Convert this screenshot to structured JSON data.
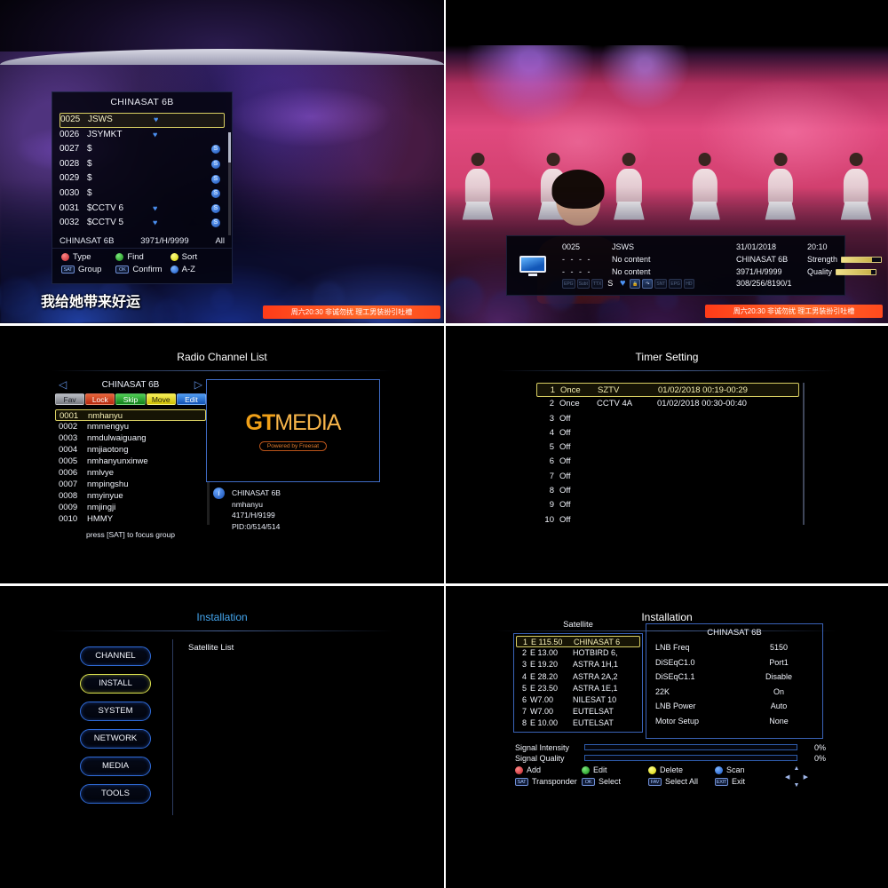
{
  "panels": {
    "channel_list_tv": {
      "osd_title": "CHINASAT 6B",
      "rows": [
        {
          "num": "0025",
          "name": "JSWS",
          "heart": true,
          "scrambled": false
        },
        {
          "num": "0026",
          "name": "JSYMKT",
          "heart": true,
          "scrambled": false
        },
        {
          "num": "0027",
          "name": "$",
          "heart": false,
          "scrambled": true
        },
        {
          "num": "0028",
          "name": "$",
          "heart": false,
          "scrambled": true
        },
        {
          "num": "0029",
          "name": "$",
          "heart": false,
          "scrambled": true
        },
        {
          "num": "0030",
          "name": "$",
          "heart": false,
          "scrambled": true
        },
        {
          "num": "0031",
          "name": "$CCTV 6",
          "heart": true,
          "scrambled": true
        },
        {
          "num": "0032",
          "name": "$CCTV 5",
          "heart": true,
          "scrambled": true
        }
      ],
      "footer": {
        "satellite": "CHINASAT 6B",
        "transponder": "3971/H/9999",
        "group": "All"
      },
      "hints": [
        {
          "key": "red",
          "label": "Type"
        },
        {
          "key": "green",
          "label": "Find"
        },
        {
          "key": "yellow",
          "label": "Sort"
        },
        {
          "key": "SAT",
          "label": "Group"
        },
        {
          "key": "OK",
          "label": "Confirm"
        },
        {
          "key": "blue",
          "label": "A-Z"
        }
      ],
      "subtitle": "我给她带来好运",
      "ticker": "周六20:30 非诚勿扰 理工男装扮引吐槽"
    },
    "info_bar_tv": {
      "channel_number": "0025",
      "channel_name": "JSWS",
      "now_time": "- - - -",
      "now_title": "No content",
      "next_time": "- - - -",
      "next_title": "No content",
      "date": "31/01/2018",
      "clock": "20:10",
      "satellite": "CHINASAT 6B",
      "transponder": "3971/H/9999",
      "pids": "308/256/8190/1",
      "strength_label": "Strength",
      "strength_pct": 78,
      "quality_label": "Quality",
      "quality_pct": 88,
      "icons": [
        "EPG",
        "Subt",
        "TTX",
        "S",
        "heart",
        "lock",
        "audio",
        "SNT",
        "EPG2",
        "HD"
      ],
      "ticker": "周六20:30 非诚勿扰 理工男装扮引吐槽"
    },
    "radio_channel_list": {
      "title": "Radio Channel List",
      "satellite": "CHINASAT 6B",
      "tabs": [
        "Fav",
        "Lock",
        "Skip",
        "Move",
        "Edit"
      ],
      "rows": [
        {
          "num": "0001",
          "name": "nmhanyu"
        },
        {
          "num": "0002",
          "name": "nmmengyu"
        },
        {
          "num": "0003",
          "name": "nmdulwaiguang"
        },
        {
          "num": "0004",
          "name": "nmjiaotong"
        },
        {
          "num": "0005",
          "name": "nmhanyunxinwe"
        },
        {
          "num": "0006",
          "name": "nmlvye"
        },
        {
          "num": "0007",
          "name": "nmpingshu"
        },
        {
          "num": "0008",
          "name": "nmyinyue"
        },
        {
          "num": "0009",
          "name": "nmjingji"
        },
        {
          "num": "0010",
          "name": "HMMY"
        }
      ],
      "note": "press [SAT] to focus group",
      "logo": {
        "gt": "GT",
        "media": "MEDIA",
        "tagline": "Powered by Freesat"
      },
      "info": [
        "CHINASAT 6B",
        "nmhanyu",
        "4171/H/9199",
        "PID:0/514/514"
      ]
    },
    "timer_setting": {
      "title": "Timer Setting",
      "rows": [
        {
          "idx": "1",
          "mode": "Once",
          "channel": "SZTV",
          "time": "01/02/2018 00:19-00:29"
        },
        {
          "idx": "2",
          "mode": "Once",
          "channel": "CCTV 4A",
          "time": "01/02/2018 00:30-00:40"
        },
        {
          "idx": "3",
          "mode": "Off",
          "channel": "",
          "time": ""
        },
        {
          "idx": "4",
          "mode": "Off",
          "channel": "",
          "time": ""
        },
        {
          "idx": "5",
          "mode": "Off",
          "channel": "",
          "time": ""
        },
        {
          "idx": "6",
          "mode": "Off",
          "channel": "",
          "time": ""
        },
        {
          "idx": "7",
          "mode": "Off",
          "channel": "",
          "time": ""
        },
        {
          "idx": "8",
          "mode": "Off",
          "channel": "",
          "time": ""
        },
        {
          "idx": "9",
          "mode": "Off",
          "channel": "",
          "time": ""
        },
        {
          "idx": "10",
          "mode": "Off",
          "channel": "",
          "time": ""
        }
      ]
    },
    "installation_menu": {
      "title": "Installation",
      "buttons": [
        "CHANNEL",
        "INSTALL",
        "SYSTEM",
        "NETWORK",
        "MEDIA",
        "TOOLS"
      ],
      "selected": "INSTALL",
      "right_label": "Satellite List"
    },
    "installation_satellite": {
      "title": "Installation",
      "satellite_header": "Satellite",
      "satellites": [
        {
          "idx": "1",
          "pos": "E 115.50",
          "name": "CHINASAT 6"
        },
        {
          "idx": "2",
          "pos": "E 13.00",
          "name": "HOTBIRD 6,"
        },
        {
          "idx": "3",
          "pos": "E 19.20",
          "name": "ASTRA 1H,1"
        },
        {
          "idx": "4",
          "pos": "E 28.20",
          "name": "ASTRA 2A,2"
        },
        {
          "idx": "5",
          "pos": "E 23.50",
          "name": "ASTRA 1E,1"
        },
        {
          "idx": "6",
          "pos": "W7.00",
          "name": "NILESAT 10"
        },
        {
          "idx": "7",
          "pos": "W7.00",
          "name": "EUTELSAT"
        },
        {
          "idx": "8",
          "pos": "E 10.00",
          "name": "EUTELSAT"
        }
      ],
      "lnb_title": "CHINASAT 6B",
      "lnb": [
        {
          "k": "LNB Freq",
          "v": "5150"
        },
        {
          "k": "DiSEqC1.0",
          "v": "Port1"
        },
        {
          "k": "DiSEqC1.1",
          "v": "Disable"
        },
        {
          "k": "22K",
          "v": "On"
        },
        {
          "k": "LNB Power",
          "v": "Auto"
        },
        {
          "k": "Motor Setup",
          "v": "None"
        }
      ],
      "signal_intensity_label": "Signal Intensity",
      "signal_intensity_pct": "0%",
      "signal_quality_label": "Signal Quality",
      "signal_quality_pct": "0%",
      "hints": [
        {
          "key": "red",
          "label": "Add"
        },
        {
          "key": "green",
          "label": "Edit"
        },
        {
          "key": "yellow",
          "label": "Delete"
        },
        {
          "key": "blue",
          "label": "Scan"
        },
        {
          "key": "SAT",
          "label": "Transponder"
        },
        {
          "key": "OK",
          "label": "Select"
        },
        {
          "key": "FAV",
          "label": "Select All"
        },
        {
          "key": "EXIT",
          "label": "Exit"
        }
      ]
    }
  },
  "colors": {
    "highlight": "#d9cf63",
    "osd_border": "#3a63b8",
    "accent_blue": "#45a7f0",
    "logo_orange": "#f0a018"
  }
}
